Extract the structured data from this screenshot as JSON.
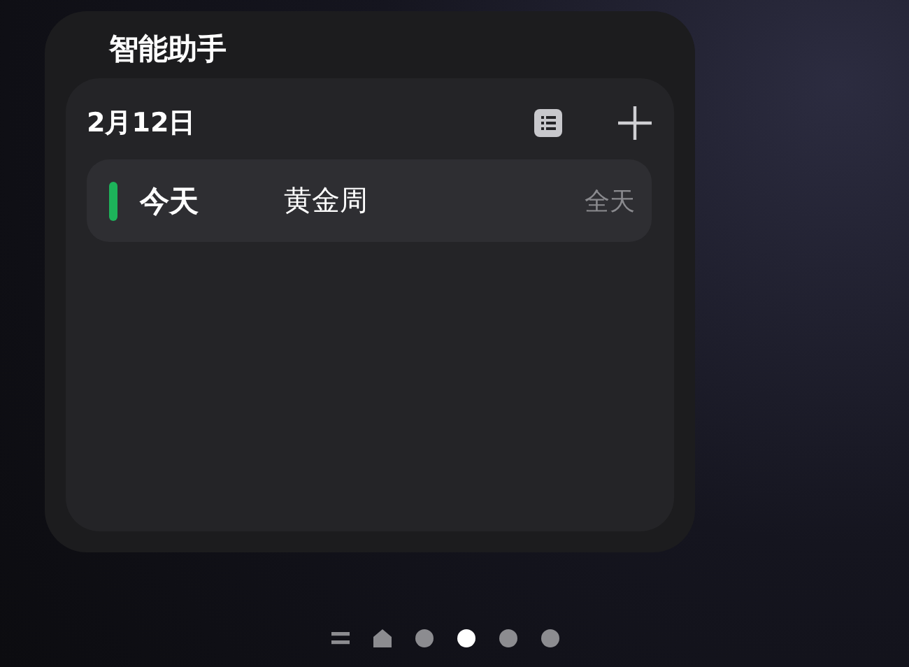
{
  "widget": {
    "title": "智能助手",
    "date": "2月12日",
    "events": [
      {
        "day": "今天",
        "name": "黄金周",
        "time": "全天",
        "color": "#1db35a"
      }
    ]
  },
  "page_indicator": [
    {
      "kind": "menu",
      "selected": false
    },
    {
      "kind": "home",
      "selected": false
    },
    {
      "kind": "dot",
      "selected": false
    },
    {
      "kind": "dot",
      "selected": true
    },
    {
      "kind": "dot",
      "selected": false
    },
    {
      "kind": "dot",
      "selected": false
    }
  ]
}
